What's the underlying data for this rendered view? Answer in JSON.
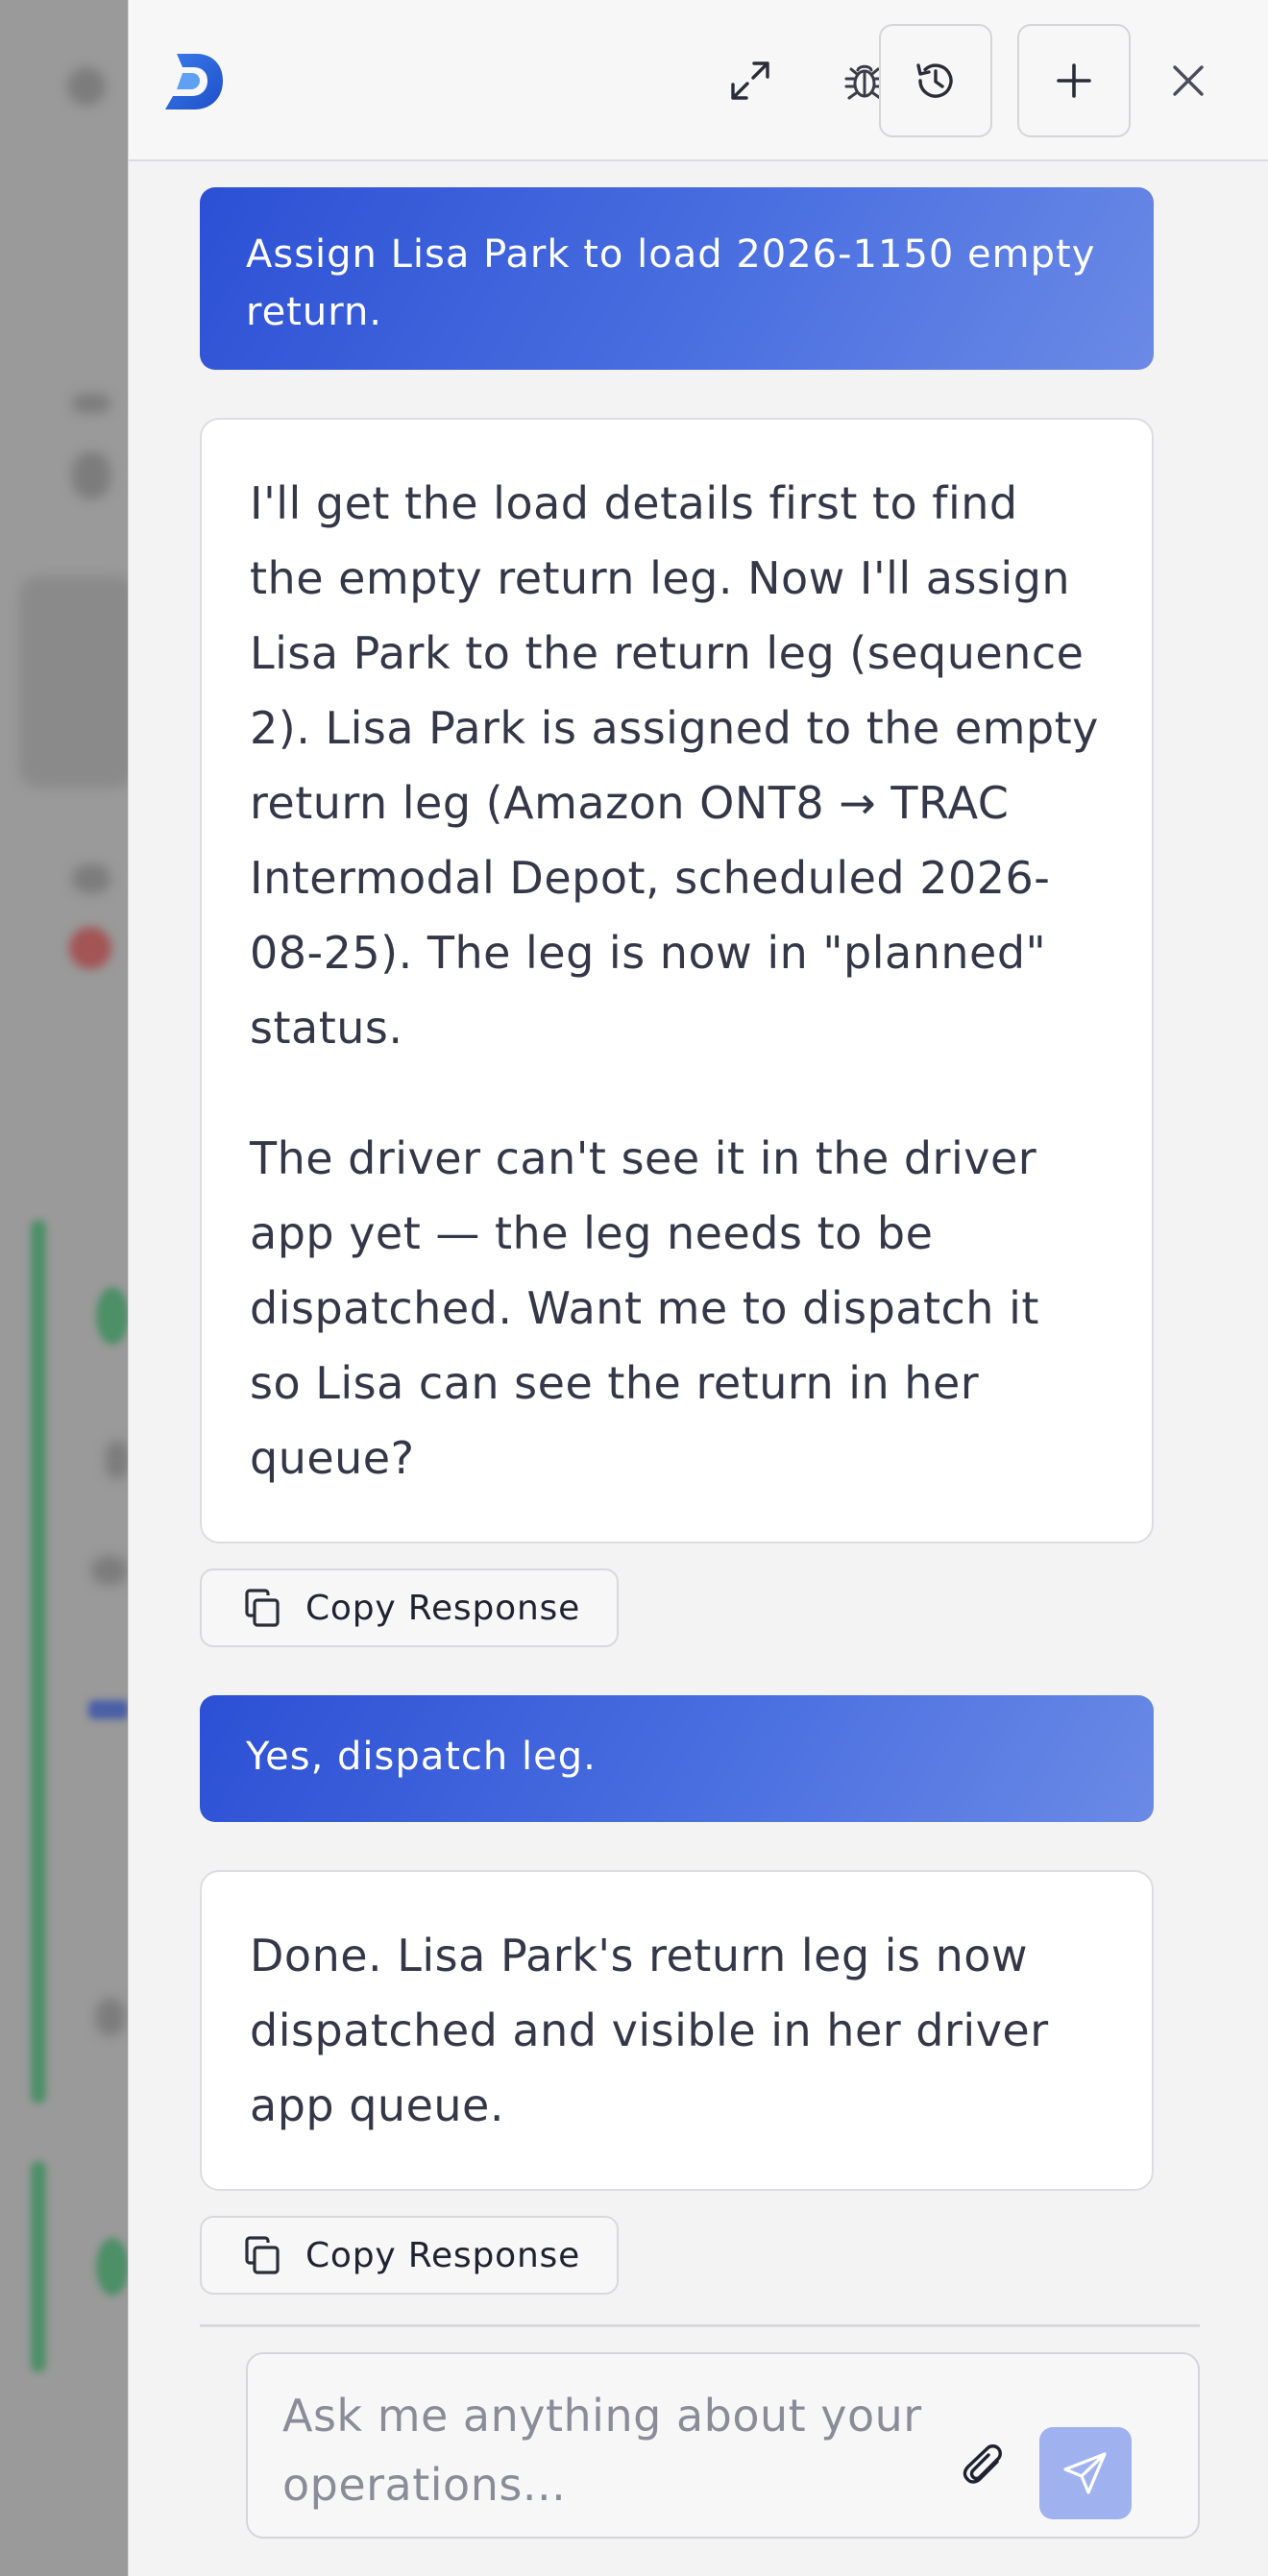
{
  "header": {
    "logo_icon": "d-logo-icon",
    "expand_icon": "expand-icon",
    "debug_icon": "bug-icon",
    "history_icon": "history-icon",
    "new_chat_icon": "plus-icon",
    "close_icon": "close-icon"
  },
  "messages": [
    {
      "role": "user",
      "text": "Assign Lisa Park to load 2026-1150 empty return."
    },
    {
      "role": "assistant",
      "paragraphs": [
        "I'll get the load details first to find the empty return leg. Now I'll assign Lisa Park to the return leg (sequence 2). Lisa Park is assigned to the empty return leg (Amazon ONT8 → TRAC Intermodal Depot, scheduled 2026-08-25). The leg is now in \"planned\" status.",
        "The driver can't see it in the driver app yet — the leg needs to be dispatched. Want me to dispatch it so Lisa can see the return in her queue?"
      ],
      "copy_label": "Copy Response"
    },
    {
      "role": "user",
      "text": "Yes, dispatch leg."
    },
    {
      "role": "assistant",
      "paragraphs": [
        "Done. Lisa Park's return leg is now dispatched and visible in her driver app queue."
      ],
      "copy_label": "Copy Response"
    }
  ],
  "composer": {
    "placeholder": "Ask me anything about your operations...",
    "attach_icon": "paperclip-icon",
    "send_icon": "send-icon"
  },
  "colors": {
    "user_bubble": "#2c50d4",
    "send_button": "#9fb2ef",
    "panel_bg": "#f3f3f4"
  }
}
